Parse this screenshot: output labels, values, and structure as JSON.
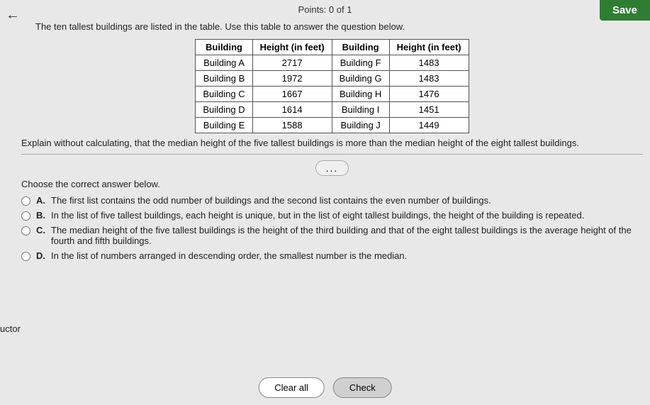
{
  "points": "Points: 0 of 1",
  "save_label": "Save",
  "back_icon": "←",
  "intro": "The ten tallest buildings are listed in the table. Use this table to answer the question below.",
  "table": {
    "col1_header": "Building",
    "col2_header": "Height (in feet)",
    "col3_header": "Building",
    "col4_header": "Height (in feet)",
    "rows_left": [
      {
        "building": "Building A",
        "height": "2717"
      },
      {
        "building": "Building B",
        "height": "1972"
      },
      {
        "building": "Building C",
        "height": "1667"
      },
      {
        "building": "Building D",
        "height": "1614"
      },
      {
        "building": "Building E",
        "height": "1588"
      }
    ],
    "rows_right": [
      {
        "building": "Building F",
        "height": "1483"
      },
      {
        "building": "Building G",
        "height": "1483"
      },
      {
        "building": "Building H",
        "height": "1476"
      },
      {
        "building": "Building I",
        "height": "1451"
      },
      {
        "building": "Building J",
        "height": "1449"
      }
    ]
  },
  "explain_text": "Explain without calculating, that the median height of the five tallest buildings is more than the median height of the eight tallest buildings.",
  "dots": "...",
  "choose_correct": "Choose the correct answer below.",
  "options": [
    {
      "key": "A",
      "text": "The first list contains the odd number of buildings and the second list contains the even number of buildings."
    },
    {
      "key": "B",
      "text": "In the list of five tallest buildings, each height is unique, but in the list of eight tallest buildings, the height of the building is repeated."
    },
    {
      "key": "C",
      "text": "The median height of the five tallest buildings is the height of the third building and that of the eight tallest buildings is the average height of the fourth and fifth buildings."
    },
    {
      "key": "D",
      "text": "In the list of numbers arranged in descending order, the smallest number is the median."
    }
  ],
  "clear_label": "Clear all",
  "check_label": "Check",
  "side_label": "uctor"
}
